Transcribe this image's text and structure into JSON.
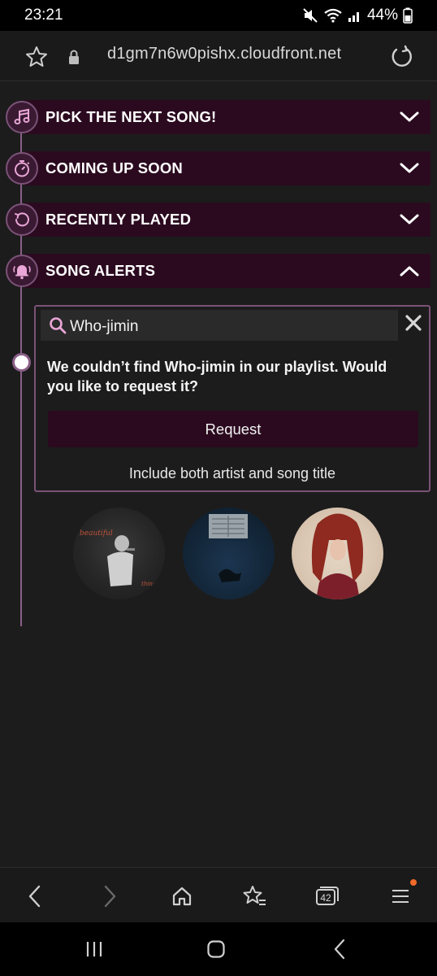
{
  "status_bar": {
    "time": "23:21",
    "battery": "44%"
  },
  "browser": {
    "url": "d1gm7n6w0pishx.cloudfront.net",
    "tab_count": "42"
  },
  "sections": [
    {
      "label": "PICK THE NEXT SONG!",
      "icon": "music-note-icon",
      "expanded": false
    },
    {
      "label": "COMING UP SOON",
      "icon": "stopwatch-icon",
      "expanded": false
    },
    {
      "label": "RECENTLY PLAYED",
      "icon": "history-icon",
      "expanded": false
    },
    {
      "label": "SONG ALERTS",
      "icon": "bell-icon",
      "expanded": true
    }
  ],
  "song_alerts": {
    "search_value": "Who-jimin",
    "not_found_message": "We couldn’t find Who-jimin in our playlist. Would you like to request it?",
    "request_label": "Request",
    "hint": "Include both artist and song title"
  },
  "covers": [
    {
      "caption_top": "beautiful",
      "caption_bottom": "things"
    },
    {
      "caption_top": "",
      "caption_bottom": ""
    },
    {
      "caption_top": "",
      "caption_bottom": ""
    }
  ],
  "colors": {
    "accent_dark": "#2b0a1f",
    "accent_border": "#7b5277",
    "icon_pink": "#e9a6d6"
  }
}
